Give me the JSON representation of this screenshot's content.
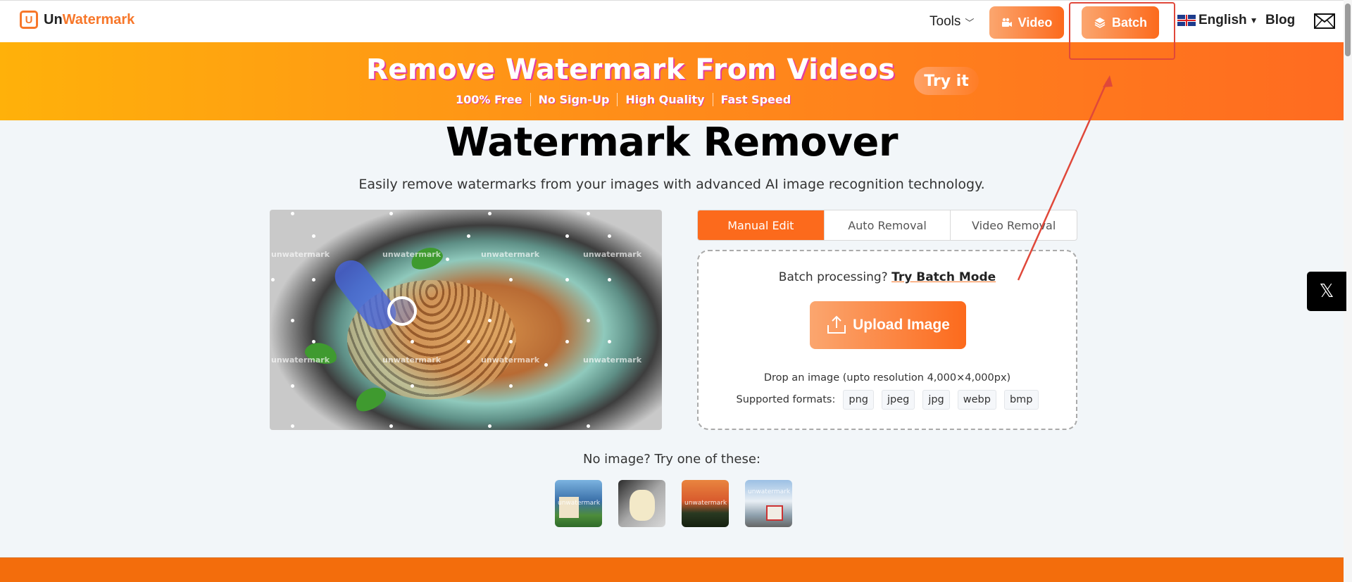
{
  "header": {
    "logo": {
      "prefix": "Un",
      "suffix": "Watermark",
      "mark": "U"
    },
    "nav": {
      "tools_label": "Tools",
      "video_label": "Video",
      "batch_label": "Batch",
      "language_label": "English",
      "blog_label": "Blog"
    },
    "icons": {
      "tools_chevron": "chevron-down-icon",
      "video": "video-camera-icon",
      "batch": "layers-icon",
      "language_flag": "uk-flag-icon",
      "language_caret": "caret-down-icon",
      "mail": "mail-icon"
    }
  },
  "banner": {
    "title": "Remove Watermark From Videos",
    "features": [
      "100% Free",
      "No Sign-Up",
      "High Quality",
      "Fast Speed"
    ],
    "cta_label": "Try it"
  },
  "main": {
    "title": "Watermark Remover",
    "subtitle": "Easily remove watermarks from your images with advanced AI image recognition technology.",
    "demo_watermark_text": "unwatermark",
    "tabs": [
      {
        "label": "Manual Edit",
        "active": true
      },
      {
        "label": "Auto Removal",
        "active": false
      },
      {
        "label": "Video Removal",
        "active": false
      }
    ],
    "upload": {
      "batch_prompt": "Batch processing?",
      "batch_link": "Try Batch Mode",
      "button_label": "Upload Image",
      "drop_text": "Drop an image (upto resolution 4,000×4,000px)",
      "formats_label": "Supported formats:",
      "formats": [
        "png",
        "jpeg",
        "jpg",
        "webp",
        "bmp"
      ]
    },
    "samples": {
      "label": "No image? Try one of these:",
      "items": [
        {
          "name": "house-sample",
          "watermark": "unwatermark"
        },
        {
          "name": "cat-sample",
          "watermark": ""
        },
        {
          "name": "sunset-sample",
          "watermark": "unwatermark"
        },
        {
          "name": "bus-sample",
          "watermark": "unwatermark"
        }
      ]
    }
  },
  "side": {
    "x_button_glyph": "𝕏"
  },
  "colors": {
    "brand_orange": "#fc6a1c",
    "brand_orange_light": "#fba66f",
    "banner_yellow": "#ffb10a",
    "title_shadow_pink": "#e43ea0",
    "annotation_red": "#e0483a",
    "page_bg": "#f2f6f9"
  }
}
